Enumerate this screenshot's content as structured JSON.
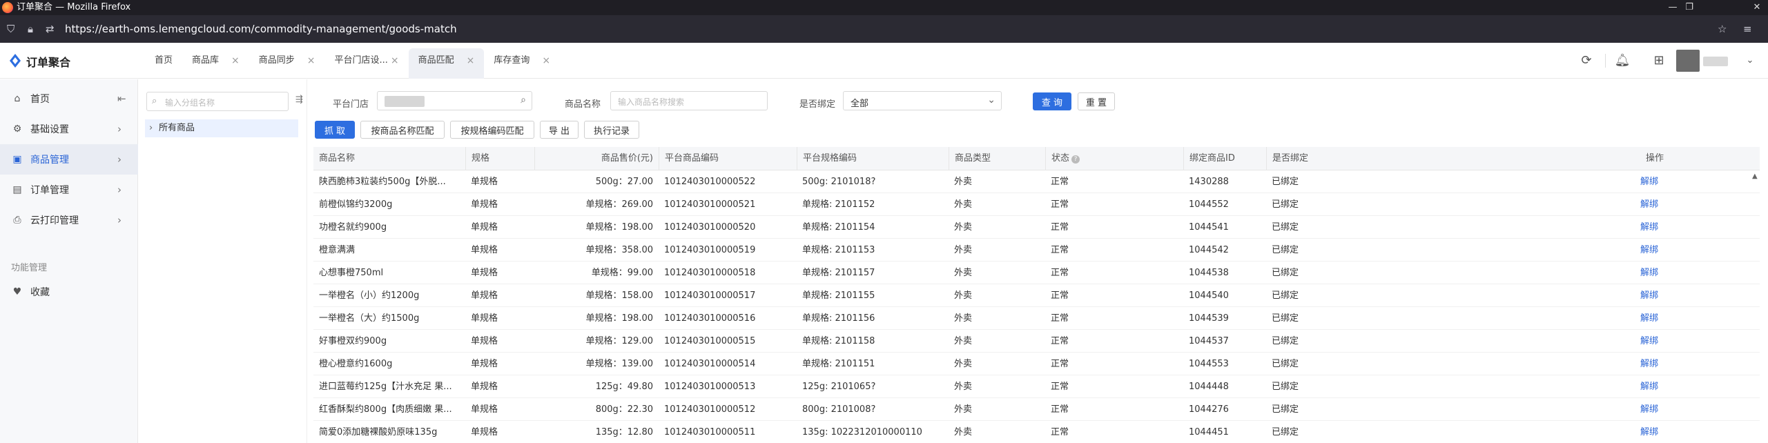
{
  "browser": {
    "window_title": "订单聚合 — Mozilla Firefox",
    "url_prefix": "https://earth-oms.",
    "url_host": "lemengcloud.com",
    "url_path": "/commodity-management/goods-match"
  },
  "header": {
    "app_name": "订单聚合",
    "brand_color": "#2d6ee0",
    "tabs": [
      {
        "label": "首页"
      },
      {
        "label": "商品库"
      },
      {
        "label": "商品同步"
      },
      {
        "label": "平台门店设..."
      },
      {
        "label": "商品匹配"
      },
      {
        "label": "库存查询"
      }
    ],
    "active_tab": "商品匹配"
  },
  "sidebar": {
    "items": [
      {
        "label": "首页",
        "icon": "home-icon"
      },
      {
        "label": "基础设置",
        "icon": "settings-icon"
      },
      {
        "label": "商品管理",
        "icon": "box-icon"
      },
      {
        "label": "订单管理",
        "icon": "order-icon"
      },
      {
        "label": "云打印管理",
        "icon": "printer-icon"
      }
    ],
    "group_title": "功能管理",
    "favorite_label": "收藏"
  },
  "tree": {
    "search_placeholder": "输入分组名称",
    "root_label": "所有商品"
  },
  "filters": {
    "store_label": "平台门店",
    "product_name_label": "商品名称",
    "product_name_placeholder": "输入商品名称搜索",
    "bound_label": "是否绑定",
    "bound_value": "全部",
    "query_button": "查 询",
    "reset_button": "重 置"
  },
  "actions": {
    "fetch": "抓 取",
    "match_by_name": "按商品名称匹配",
    "match_by_spec_code": "按规格编码匹配",
    "export": "导 出",
    "records": "执行记录"
  },
  "table": {
    "headers": [
      "商品名称",
      "规格",
      "商品售价(元)",
      "平台商品编码",
      "平台规格编码",
      "商品类型",
      "状态",
      "绑定商品ID",
      "是否绑定",
      "操作"
    ],
    "rows": [
      [
        "陕西脆柿3粒装约500g【外脱...",
        "单规格",
        "500g：27.00",
        "1012403010000522",
        "500g: 2101018?",
        "外卖",
        "正常",
        "1430288",
        "已绑定",
        "解绑"
      ],
      [
        "前橙似锦约3200g",
        "单规格",
        "单规格：269.00",
        "1012403010000521",
        "单规格: 2101152",
        "外卖",
        "正常",
        "1044552",
        "已绑定",
        "解绑"
      ],
      [
        "功橙名就约900g",
        "单规格",
        "单规格：198.00",
        "1012403010000520",
        "单规格: 2101154",
        "外卖",
        "正常",
        "1044541",
        "已绑定",
        "解绑"
      ],
      [
        "橙意满满",
        "单规格",
        "单规格：358.00",
        "1012403010000519",
        "单规格: 2101153",
        "外卖",
        "正常",
        "1044542",
        "已绑定",
        "解绑"
      ],
      [
        "心想事橙750ml",
        "单规格",
        "单规格：99.00",
        "1012403010000518",
        "单规格: 2101157",
        "外卖",
        "正常",
        "1044538",
        "已绑定",
        "解绑"
      ],
      [
        "一举橙名（小）约1200g",
        "单规格",
        "单规格：158.00",
        "1012403010000517",
        "单规格: 2101155",
        "外卖",
        "正常",
        "1044540",
        "已绑定",
        "解绑"
      ],
      [
        "一举橙名（大）约1500g",
        "单规格",
        "单规格：198.00",
        "1012403010000516",
        "单规格: 2101156",
        "外卖",
        "正常",
        "1044539",
        "已绑定",
        "解绑"
      ],
      [
        "好事橙双约900g",
        "单规格",
        "单规格：129.00",
        "1012403010000515",
        "单规格: 2101158",
        "外卖",
        "正常",
        "1044537",
        "已绑定",
        "解绑"
      ],
      [
        "橙心橙意约1600g",
        "单规格",
        "单规格：139.00",
        "1012403010000514",
        "单规格: 2101151",
        "外卖",
        "正常",
        "1044553",
        "已绑定",
        "解绑"
      ],
      [
        "进口蓝莓约125g【汁水充足 果...",
        "单规格",
        "125g：49.80",
        "1012403010000513",
        "125g: 2101065?",
        "外卖",
        "正常",
        "1044448",
        "已绑定",
        "解绑"
      ],
      [
        "红香酥梨约800g【肉质细嫩 果...",
        "单规格",
        "800g：22.30",
        "1012403010000512",
        "800g: 2101008?",
        "外卖",
        "正常",
        "1044276",
        "已绑定",
        "解绑"
      ],
      [
        "简爱0添加糖裸酸奶原味135g",
        "单规格",
        "135g：12.80",
        "1012403010000511",
        "135g: 1022312010000110",
        "外卖",
        "正常",
        "1044451",
        "已绑定",
        "解绑"
      ]
    ]
  }
}
